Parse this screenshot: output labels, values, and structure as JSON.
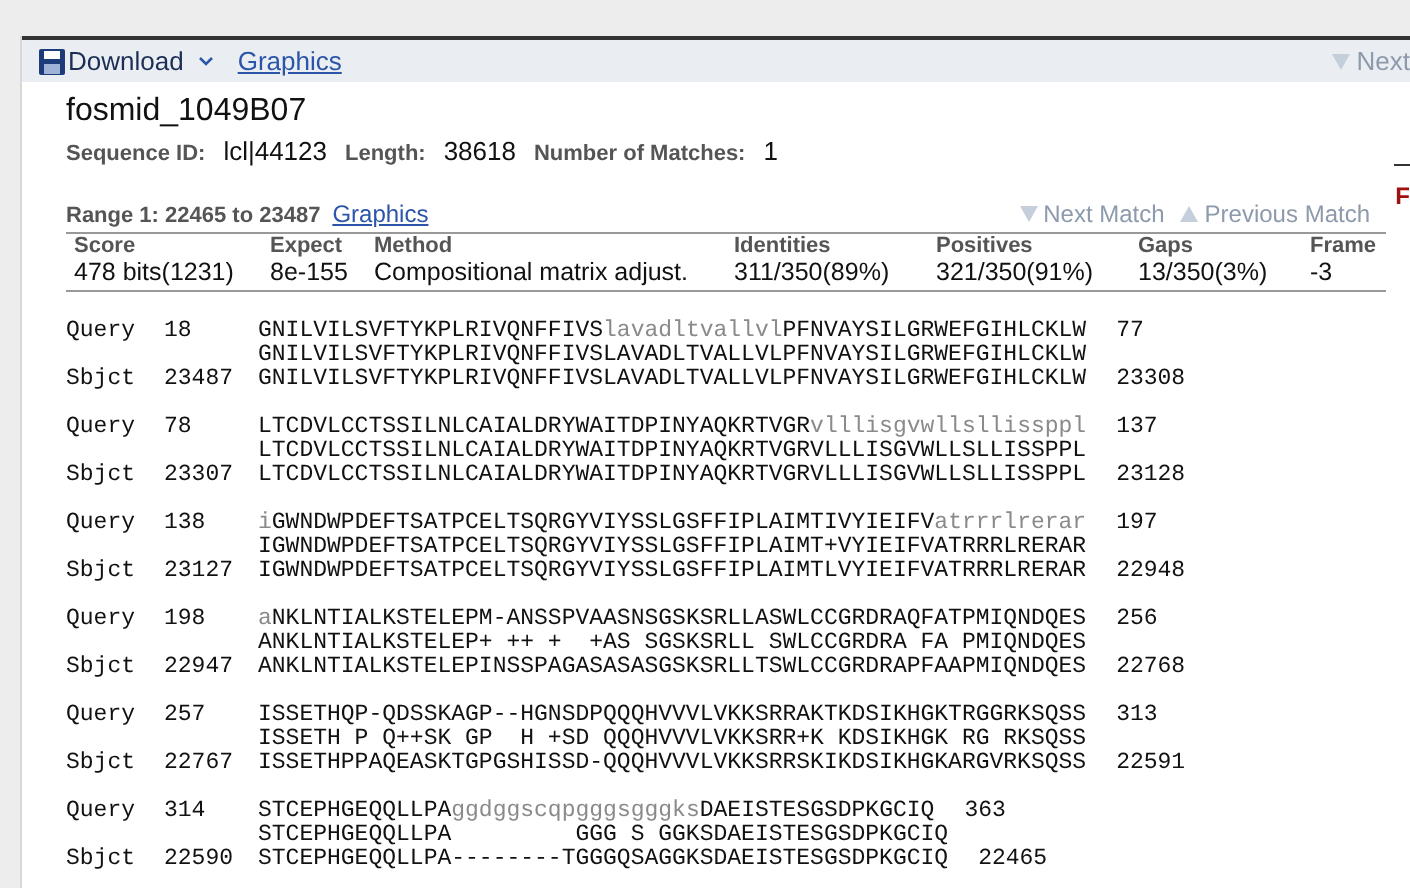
{
  "toolbar": {
    "download": "Download",
    "graphics": "Graphics",
    "next": "Next"
  },
  "title": "fosmid_1049B07",
  "meta": [
    {
      "label": "Sequence ID:",
      "value": "lcl|44123"
    },
    {
      "label": "Length:",
      "value": "38618"
    },
    {
      "label": "Number of Matches:",
      "value": "1"
    }
  ],
  "edge_text": "F",
  "range": {
    "label": "Range 1: 22465 to 23487",
    "graphics": "Graphics",
    "next_match": "Next Match",
    "previous_match": "Previous Match"
  },
  "stats": {
    "columns": [
      "Score",
      "Expect",
      "Method",
      "Identities",
      "Positives",
      "Gaps",
      "Frame"
    ],
    "values": [
      "478 bits(1231)",
      "8e-155",
      "Compositional matrix adjust.",
      "311/350(89%)",
      "321/350(91%)",
      "13/350(3%)",
      "-3"
    ]
  },
  "alignments": [
    {
      "query_label": "Query",
      "query_start": "18",
      "query": [
        {
          "text": "GNILVILSVFTYKPLRIVQNFFIVS",
          "masked": false
        },
        {
          "text": "lavadltvallvl",
          "masked": true
        },
        {
          "text": "PFNVAYSILGRWEFGIHLCKLW",
          "masked": false
        }
      ],
      "query_end": "77",
      "midline": "GNILVILSVFTYKPLRIVQNFFIVSLAVADLTVALLVLPFNVAYSILGRWEFGIHLCKLW",
      "sbjct_label": "Sbjct",
      "sbjct_start": "23487",
      "sbjct": "GNILVILSVFTYKPLRIVQNFFIVSLAVADLTVALLVLPFNVAYSILGRWEFGIHLCKLW",
      "sbjct_end": "23308"
    },
    {
      "query_label": "Query",
      "query_start": "78",
      "query": [
        {
          "text": "LTCDVLCCTSSILNLCAIALDRYWAITDPINYAQKRTVGR",
          "masked": false
        },
        {
          "text": "vlllisgvwllsllissppl",
          "masked": true
        }
      ],
      "query_end": "137",
      "midline": "LTCDVLCCTSSILNLCAIALDRYWAITDPINYAQKRTVGRVLLLISGVWLLSLLISSPPL",
      "sbjct_label": "Sbjct",
      "sbjct_start": "23307",
      "sbjct": "LTCDVLCCTSSILNLCAIALDRYWAITDPINYAQKRTVGRVLLLISGVWLLSLLISSPPL",
      "sbjct_end": "23128"
    },
    {
      "query_label": "Query",
      "query_start": "138",
      "query": [
        {
          "text": "i",
          "masked": true
        },
        {
          "text": "GWNDWPDEFTSATPCELTSQRGYVIYSSLGSFFIPLAIMTIVYIEIFV",
          "masked": false
        },
        {
          "text": "atrrrlrerar",
          "masked": true
        }
      ],
      "query_end": "197",
      "midline": "IGWNDWPDEFTSATPCELTSQRGYVIYSSLGSFFIPLAIMT+VYIEIFVATRRRLRERAR",
      "sbjct_label": "Sbjct",
      "sbjct_start": "23127",
      "sbjct": "IGWNDWPDEFTSATPCELTSQRGYVIYSSLGSFFIPLAIMTLVYIEIFVATRRRLRERAR",
      "sbjct_end": "22948"
    },
    {
      "query_label": "Query",
      "query_start": "198",
      "query": [
        {
          "text": "a",
          "masked": true
        },
        {
          "text": "NKLNTIALKSTELEPM-ANSSPVAASNSGSKSRLLASWLCCGRDRAQFATPMIQNDQES",
          "masked": false
        }
      ],
      "query_end": "256",
      "midline": "ANKLNTIALKSTELEP+ ++ +  +AS SGSKSRLL SWLCCGRDRA FA PMIQNDQES",
      "sbjct_label": "Sbjct",
      "sbjct_start": "22947",
      "sbjct": "ANKLNTIALKSTELEPINSSPAGASASASGSKSRLLTSWLCCGRDRAPFAAPMIQNDQES",
      "sbjct_end": "22768"
    },
    {
      "query_label": "Query",
      "query_start": "257",
      "query": [
        {
          "text": "ISSETHQP-QDSSKAGP--HGNSDPQQQHVVVLVKKSRRAKTKDSIKHGKTRGGRKSQSS",
          "masked": false
        }
      ],
      "query_end": "313",
      "midline": "ISSETH P Q++SK GP  H +SD QQQHVVVLVKKSRR+K KDSIKHGK RG RKSQSS",
      "sbjct_label": "Sbjct",
      "sbjct_start": "22767",
      "sbjct": "ISSETHPPAQEASKTGPGSHISSD-QQQHVVVLVKKSRRSKIKDSIKHGKARGVRKSQSS",
      "sbjct_end": "22591"
    },
    {
      "query_label": "Query",
      "query_start": "314",
      "query": [
        {
          "text": "STCEPHGEQQLLPA",
          "masked": false
        },
        {
          "text": "ggdggscqpgggsgggks",
          "masked": true
        },
        {
          "text": "DAEISTESGSDPKGCIQ",
          "masked": false
        }
      ],
      "query_end": "363",
      "midline": "STCEPHGEQQLLPA         GGG S GGKSDAEISTESGSDPKGCIQ",
      "sbjct_label": "Sbjct",
      "sbjct_start": "22590",
      "sbjct": "STCEPHGEQQLLPA--------TGGGQSAGGKSDAEISTESGSDPKGCIQ",
      "sbjct_end": "22465"
    }
  ]
}
